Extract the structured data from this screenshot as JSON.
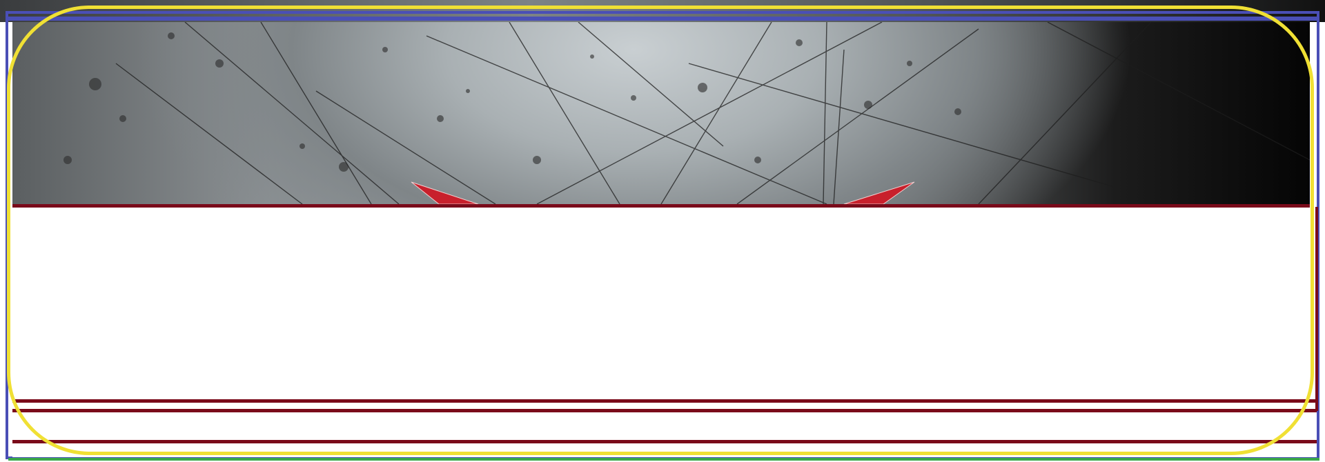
{
  "page": {
    "colors": {
      "outer_frame": "#4a4fb6",
      "section_rule": "#7a0a1a",
      "highlight_oval": "#f0e034",
      "bottom_rule": "#3aa84a",
      "banner_accent": "#c8202c"
    },
    "banner": {
      "style": "scratched-metal-texture",
      "decor": [
        "red-blade-left",
        "red-blade-right"
      ]
    },
    "sections": [
      {
        "name": "content-area"
      },
      {
        "name": "footer-band-1"
      },
      {
        "name": "footer-band-2"
      }
    ]
  }
}
